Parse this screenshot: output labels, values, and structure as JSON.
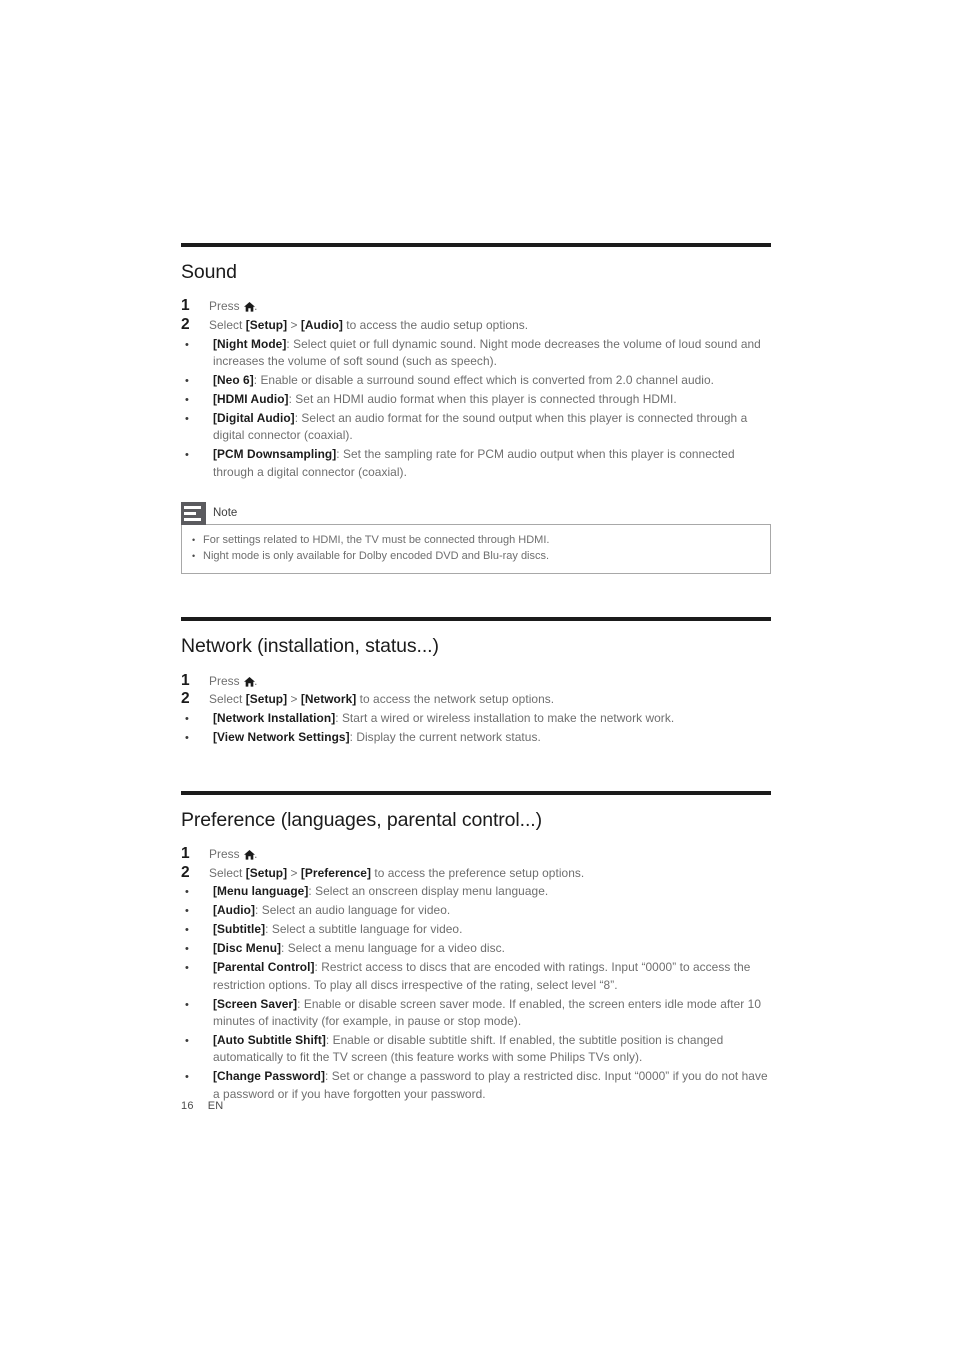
{
  "document": {
    "footer": {
      "page_number": "16",
      "language_code": "EN"
    }
  },
  "sections": [
    {
      "title": "Sound",
      "steps": [
        {
          "marker": "1",
          "type": "number",
          "html": "Press <home-icon>."
        },
        {
          "marker": "2",
          "type": "number",
          "html": "Select <b>[Setup]</b> &gt; <b>[Audio]</b> to access the audio setup options."
        },
        {
          "marker": "•",
          "type": "bullet",
          "html": "<b>[Night Mode]</b>: Select quiet or full dynamic sound. Night mode decreases the volume of loud sound and increases the volume of soft sound (such as speech)."
        },
        {
          "marker": "•",
          "type": "bullet",
          "html": "<b>[Neo 6]</b>: Enable or disable a surround sound effect which is converted from 2.0 channel audio."
        },
        {
          "marker": "•",
          "type": "bullet",
          "html": "<b>[HDMI Audio]</b>: Set an HDMI audio format when this player is connected through HDMI."
        },
        {
          "marker": "•",
          "type": "bullet",
          "html": "<b>[Digital Audio]</b>: Select an audio format for the sound output when this player is connected through a digital connector (coaxial)."
        },
        {
          "marker": "•",
          "type": "bullet",
          "html": "<b>[PCM Downsampling]</b>: Set the sampling rate for PCM audio output when this player is connected through a digital connector (coaxial)."
        }
      ],
      "note": {
        "label": "Note",
        "icon": "note-list-icon",
        "items": [
          "For settings related to HDMI, the TV must be connected through HDMI.",
          "Night mode is only available for Dolby encoded DVD and Blu-ray discs."
        ]
      }
    },
    {
      "title": "Network (installation, status...)",
      "steps": [
        {
          "marker": "1",
          "type": "number",
          "html": "Press <home-icon>."
        },
        {
          "marker": "2",
          "type": "number",
          "html": "Select <b>[Setup]</b> &gt; <b>[Network]</b> to access the network setup options."
        },
        {
          "marker": "•",
          "type": "bullet",
          "html": "<b>[Network Installation]</b>: Start a wired or wireless installation to make the network work."
        },
        {
          "marker": "•",
          "type": "bullet",
          "html": "<b>[View Network Settings]</b>: Display the current network status."
        }
      ],
      "note": null
    },
    {
      "title": "Preference (languages, parental control...)",
      "steps": [
        {
          "marker": "1",
          "type": "number",
          "html": "Press <home-icon>."
        },
        {
          "marker": "2",
          "type": "number",
          "html": "Select <b>[Setup]</b> &gt; <b>[Preference]</b> to access the preference setup options."
        },
        {
          "marker": "•",
          "type": "bullet",
          "html": "<b>[Menu language]</b>: Select an onscreen display menu language."
        },
        {
          "marker": "•",
          "type": "bullet",
          "html": "<b>[Audio]</b>: Select an audio language for video."
        },
        {
          "marker": "•",
          "type": "bullet",
          "html": "<b>[Subtitle]</b>: Select a subtitle language for video."
        },
        {
          "marker": "•",
          "type": "bullet",
          "html": "<b>[Disc Menu]</b>: Select a menu language for a video disc."
        },
        {
          "marker": "•",
          "type": "bullet",
          "html": "<b>[Parental Control]</b>: Restrict access to discs that are encoded with ratings. Input &ldquo;0000&rdquo; to access the restriction options. To play all discs irrespective of the rating, select level &ldquo;8&rdquo;."
        },
        {
          "marker": "•",
          "type": "bullet",
          "html": "<b>[Screen Saver]</b>: Enable or disable screen saver mode. If enabled, the screen enters idle mode after 10 minutes of inactivity (for example, in pause or stop mode)."
        },
        {
          "marker": "•",
          "type": "bullet",
          "html": "<b>[Auto Subtitle Shift]</b>: Enable or disable subtitle shift. If enabled, the subtitle position is changed automatically to fit the TV screen (this feature works with some Philips TVs only)."
        },
        {
          "marker": "•",
          "type": "bullet",
          "html": "<b>[Change Password]</b>: Set or change a password to play a restricted disc. Input &ldquo;0000&rdquo; if you do not have a password or if you have forgotten your password."
        }
      ],
      "note": null
    }
  ]
}
